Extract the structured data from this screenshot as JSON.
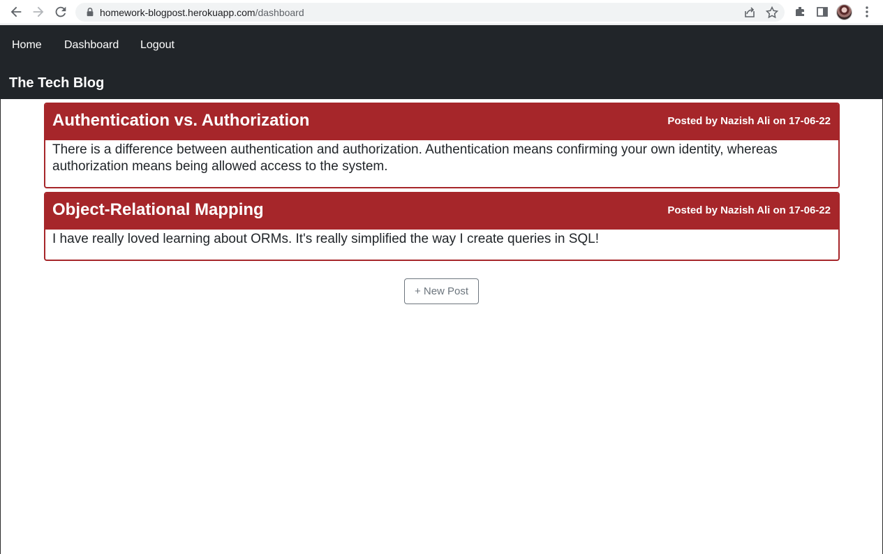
{
  "browser": {
    "url_host": "homework-blogpost.herokuapp.com",
    "url_path": "/dashboard"
  },
  "nav": {
    "links": [
      "Home",
      "Dashboard",
      "Logout"
    ],
    "brand": "The Tech Blog"
  },
  "posts": [
    {
      "title": "Authentication vs. Authorization",
      "meta": "Posted by Nazish Ali on 17-06-22",
      "body": "There is a difference between authentication and authorization. Authentication means confirming your own identity, whereas authorization means being allowed access to the system."
    },
    {
      "title": "Object-Relational Mapping",
      "meta": "Posted by Nazish Ali on 17-06-22",
      "body": "I have really loved learning about ORMs. It's really simplified the way I create queries in SQL!"
    }
  ],
  "actions": {
    "new_post_label": "+ New Post"
  },
  "colors": {
    "header_bg": "#212529",
    "card_accent": "#a6262a",
    "button_outline": "#6c757d"
  },
  "icons": [
    "back-icon",
    "forward-icon",
    "reload-icon",
    "lock-icon",
    "share-icon",
    "star-icon",
    "extensions-icon",
    "side-panel-icon",
    "profile-avatar",
    "menu-dots-icon"
  ]
}
